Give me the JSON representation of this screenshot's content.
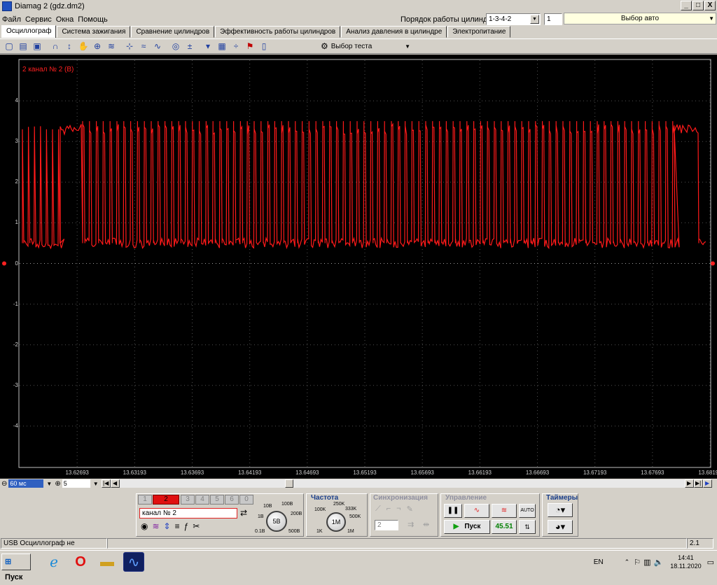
{
  "window": {
    "title": "Diamag 2 (gdz.dm2)",
    "btn_min": "_",
    "btn_max": "□",
    "btn_close": "X"
  },
  "menu": [
    "Файл",
    "Сервис",
    "Окна",
    "Помощь"
  ],
  "cylinder": {
    "label": "Порядок работы цилиндров",
    "order": "1-3-4-2",
    "count": "1",
    "auto_label": "Выбор авто"
  },
  "tabs": [
    "Осциллограф",
    "Система зажигания",
    "Сравнение цилиндров",
    "Эффективность работы цилиндров",
    "Анализ давления в цилиндре",
    "Электропитание"
  ],
  "toolbar": {
    "test_select": "Выбор теста"
  },
  "scope": {
    "channel_label": "2  канал № 2 (В)",
    "trace_color": "#ff1a1a",
    "y_ticks": [
      "4",
      "3",
      "2",
      "1",
      "0",
      "-1",
      "-2",
      "-3",
      "-4"
    ],
    "x_ticks": [
      "13.62693",
      "13.63193",
      "13.63693",
      "13.64193",
      "13.64693",
      "13.65193",
      "13.65693",
      "13.66193",
      "13.66693",
      "13.67193",
      "13.67693",
      "13.68193"
    ]
  },
  "chart_data": {
    "type": "line",
    "title": "",
    "series": [
      {
        "name": "канал № 2 (В)",
        "pattern": "square wave ~0.5 V low / ~3.3 V high"
      }
    ],
    "xlabel": "",
    "ylabel": "",
    "xlim": [
      13.62193,
      13.68193
    ],
    "ylim": [
      -5,
      5
    ],
    "low_level": 0.5,
    "high_level": 3.3,
    "grid": true
  },
  "timebase": {
    "value": "60 мс",
    "divisions": "5"
  },
  "channels": {
    "buttons": [
      "1",
      "2",
      "3",
      "4",
      "5",
      "6",
      "0"
    ],
    "active": "2",
    "name": "канал № 2"
  },
  "voltage": {
    "knob": "5В",
    "labels": [
      "10В",
      "100В",
      "1В",
      "200В",
      "0.1В",
      "500В"
    ]
  },
  "freq": {
    "title": "Частота",
    "knob": "1M",
    "labels": [
      "250K",
      "100K",
      "333K",
      "500K",
      "1K",
      "1M"
    ]
  },
  "sync": {
    "title": "Синхронизация",
    "value": "2"
  },
  "control": {
    "title": "Управление",
    "start": "Пуск",
    "value": "45.51",
    "auto": "AUTO"
  },
  "timers": {
    "title": "Таймеры"
  },
  "status": {
    "left": "USB Осциллограф не подключен",
    "right": "2.1"
  },
  "taskbar": {
    "start": "Пуск",
    "lang": "EN",
    "time": "14:41",
    "date": "18.11.2020"
  }
}
